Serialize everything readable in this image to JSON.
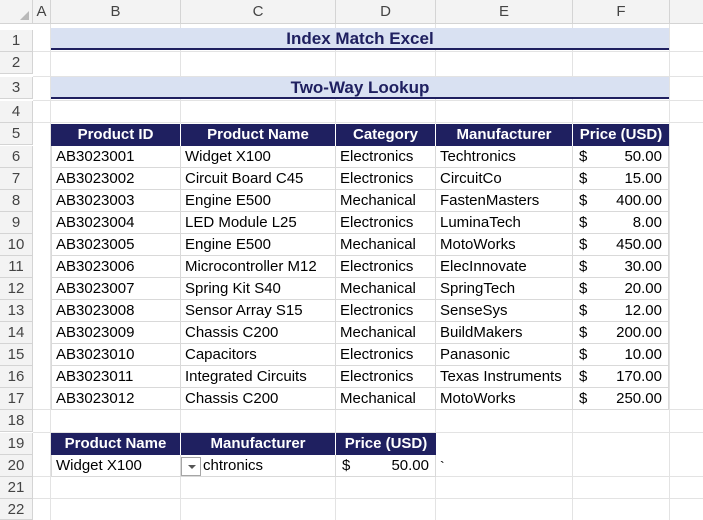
{
  "columns": [
    "A",
    "B",
    "C",
    "D",
    "E",
    "F"
  ],
  "rows": [
    "1",
    "2",
    "3",
    "4",
    "5",
    "6",
    "7",
    "8",
    "9",
    "10",
    "11",
    "12",
    "13",
    "14",
    "15",
    "16",
    "17",
    "18",
    "19",
    "20",
    "21",
    "22"
  ],
  "title": "Index Match Excel",
  "subtitle": "Two-Way Lookup",
  "table_headers": [
    "Product ID",
    "Product Name",
    "Category",
    "Manufacturer",
    "Price (USD)"
  ],
  "products": [
    {
      "id": "AB3023001",
      "name": "Widget X100",
      "category": "Electronics",
      "manufacturer": "Techtronics",
      "currency": "$",
      "price": "50.00"
    },
    {
      "id": "AB3023002",
      "name": "Circuit Board C45",
      "category": "Electronics",
      "manufacturer": "CircuitCo",
      "currency": "$",
      "price": "15.00"
    },
    {
      "id": "AB3023003",
      "name": "Engine E500",
      "category": "Mechanical",
      "manufacturer": "FastenMasters",
      "currency": "$",
      "price": "400.00"
    },
    {
      "id": "AB3023004",
      "name": "LED Module L25",
      "category": "Electronics",
      "manufacturer": "LuminaTech",
      "currency": "$",
      "price": "8.00"
    },
    {
      "id": "AB3023005",
      "name": "Engine E500",
      "category": "Mechanical",
      "manufacturer": "MotoWorks",
      "currency": "$",
      "price": "450.00"
    },
    {
      "id": "AB3023006",
      "name": "Microcontroller M12",
      "category": "Electronics",
      "manufacturer": "ElecInnovate",
      "currency": "$",
      "price": "30.00"
    },
    {
      "id": "AB3023007",
      "name": "Spring Kit S40",
      "category": "Mechanical",
      "manufacturer": "SpringTech",
      "currency": "$",
      "price": "20.00"
    },
    {
      "id": "AB3023008",
      "name": "Sensor Array S15",
      "category": "Electronics",
      "manufacturer": "SenseSys",
      "currency": "$",
      "price": "12.00"
    },
    {
      "id": "AB3023009",
      "name": "Chassis C200",
      "category": "Mechanical",
      "manufacturer": "BuildMakers",
      "currency": "$",
      "price": "200.00"
    },
    {
      "id": "AB3023010",
      "name": "Capacitors",
      "category": "Electronics",
      "manufacturer": "Panasonic",
      "currency": "$",
      "price": "10.00"
    },
    {
      "id": "AB3023011",
      "name": "Integrated Circuits",
      "category": "Electronics",
      "manufacturer": "Texas Instruments",
      "currency": "$",
      "price": "170.00"
    },
    {
      "id": "AB3023012",
      "name": "Chassis C200",
      "category": "Mechanical",
      "manufacturer": "MotoWorks",
      "currency": "$",
      "price": "250.00"
    }
  ],
  "lookup": {
    "headers": [
      "Product Name",
      "Manufacturer",
      "Price (USD)"
    ],
    "product_name": "Widget X100",
    "manufacturer": "chtronics",
    "currency": "$",
    "price": "50.00",
    "stray_mark": "`"
  },
  "colors": {
    "header_fill": "#1f2060",
    "title_fill": "#d9e1f2",
    "title_text": "#1f2060"
  }
}
